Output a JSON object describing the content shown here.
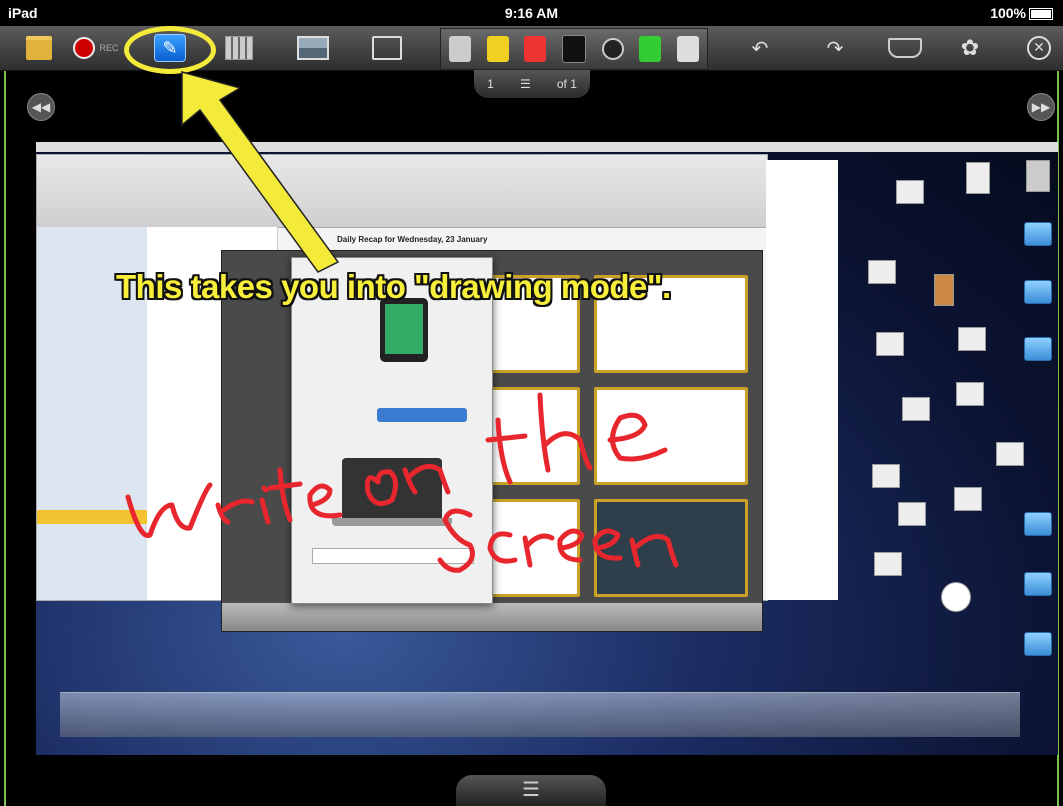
{
  "status_bar": {
    "device": "iPad",
    "time": "9:16 AM",
    "battery": "100%"
  },
  "page_nav": {
    "current": "1",
    "of_label": "of 1"
  },
  "record_label": "REC",
  "annotation": {
    "caption": "This takes you into \"drawing mode\".",
    "handwriting_line1": "Write on the",
    "handwriting_line2": "Screen"
  },
  "desktop_window": {
    "reading_pane_title": "Daily Recap for Wednesday, 23 January"
  },
  "colors": {
    "highlight": "#f4ea3a",
    "handwriting": "#e8262e",
    "canvas_border": "#7cc04c",
    "toolbar": "#3e3e3e"
  },
  "icons": [
    "folder-icon",
    "record-icon",
    "pen-icon",
    "grid-icon",
    "image-icon",
    "share-icon",
    "marker-tool-icon",
    "highlighter-tool-icon",
    "pen-red-tool-icon",
    "arrow-tool-icon",
    "lasso-tool-icon",
    "green-marker-tool-icon",
    "eraser-tool-icon",
    "undo-icon",
    "redo-icon",
    "erase-all-icon",
    "gear-icon",
    "close-icon"
  ]
}
